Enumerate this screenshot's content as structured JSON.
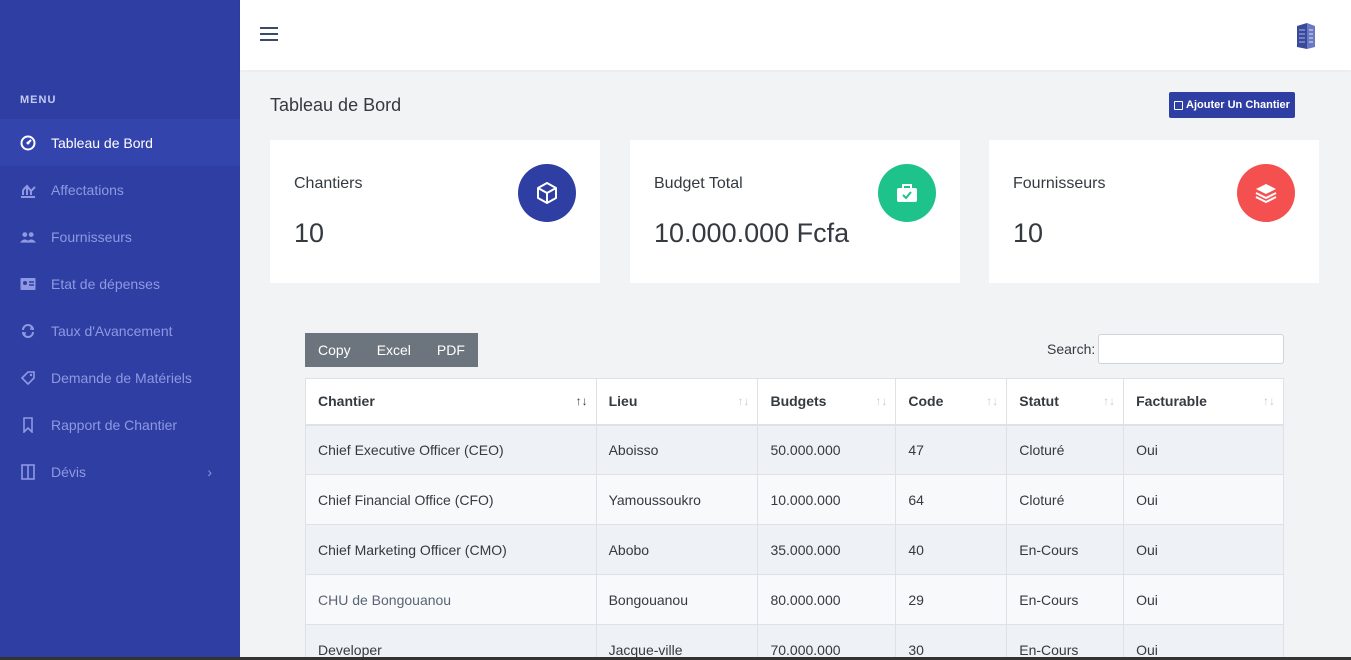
{
  "sidebar": {
    "menu_title": "MENU",
    "items": [
      {
        "label": "Tableau de Bord",
        "icon": "dashboard-icon"
      },
      {
        "label": "Affectations",
        "icon": "chart-icon"
      },
      {
        "label": "Fournisseurs",
        "icon": "users-icon"
      },
      {
        "label": "Etat de dépenses",
        "icon": "id-card-icon"
      },
      {
        "label": "Taux d'Avancement",
        "icon": "sync-icon"
      },
      {
        "label": "Demande de Matériels",
        "icon": "tag-icon"
      },
      {
        "label": "Rapport de Chantier",
        "icon": "bookmark-icon"
      },
      {
        "label": "Dévis",
        "icon": "columns-icon",
        "chevron": "›"
      }
    ]
  },
  "header": {
    "title": "Tableau de Bord",
    "add_button": "Ajouter Un Chantier"
  },
  "cards": [
    {
      "label": "Chantiers",
      "value": "10",
      "color": "#2f3ea3",
      "icon": "cube-icon"
    },
    {
      "label": "Budget Total",
      "value": "10.000.000 Fcfa",
      "color": "#1ec38b",
      "icon": "briefcase-icon"
    },
    {
      "label": "Fournisseurs",
      "value": "10",
      "color": "#f55050",
      "icon": "layers-icon"
    }
  ],
  "table": {
    "buttons": [
      "Copy",
      "Excel",
      "PDF"
    ],
    "search_label": "Search:",
    "columns": [
      "Chantier",
      "Lieu",
      "Budgets",
      "Code",
      "Statut",
      "Facturable"
    ],
    "rows": [
      [
        "Chief Executive Officer (CEO)",
        "Aboisso",
        "50.000.000",
        "47",
        "Cloturé",
        "Oui"
      ],
      [
        "Chief Financial Office (CFO)",
        "Yamoussoukro",
        "10.000.000",
        "64",
        "Cloturé",
        "Oui"
      ],
      [
        "Chief Marketing Officer (CMO)",
        "Abobo",
        "35.000.000",
        "40",
        "En-Cours",
        "Oui"
      ],
      [
        "CHU de Bongouanou",
        "Bongouanou",
        "80.000.000",
        "29",
        "En-Cours",
        "Oui"
      ],
      [
        "Developer",
        "Jacque-ville",
        "70.000.000",
        "30",
        "En-Cours",
        "Oui"
      ]
    ]
  }
}
